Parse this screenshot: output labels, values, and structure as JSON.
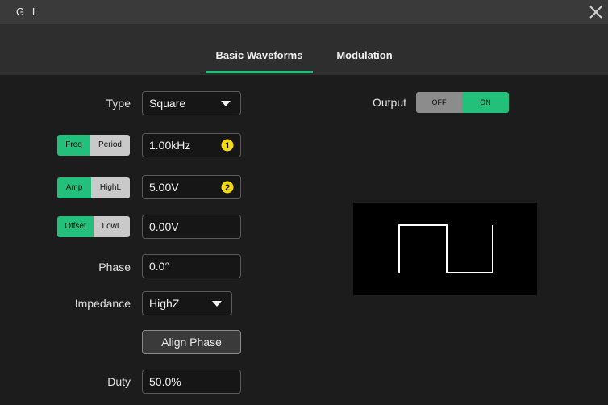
{
  "window": {
    "title": "G I"
  },
  "tabs": [
    {
      "label": "Basic Waveforms",
      "active": true
    },
    {
      "label": "Modulation",
      "active": false
    }
  ],
  "type": {
    "label": "Type",
    "value": "Square"
  },
  "freq": {
    "option_a": "Freq",
    "option_b": "Period",
    "selected": "Freq",
    "value": "1.00kHz",
    "badge": "1"
  },
  "amp": {
    "option_a": "Amp",
    "option_b": "HighL",
    "selected": "Amp",
    "value": "5.00V",
    "badge": "2"
  },
  "offset": {
    "option_a": "Offset",
    "option_b": "LowL",
    "selected": "Offset",
    "value": "0.00V"
  },
  "phase": {
    "label": "Phase",
    "value": "0.0°"
  },
  "impedance": {
    "label": "Impedance",
    "value": "HighZ"
  },
  "align_phase": {
    "label": "Align Phase"
  },
  "duty": {
    "label": "Duty",
    "value": "50.0%"
  },
  "output": {
    "label": "Output",
    "off_label": "OFF",
    "on_label": "ON",
    "state": "ON"
  },
  "colors": {
    "accent": "#22c07b",
    "badge": "#f5d90a",
    "inactive": "#c9c9c9"
  },
  "icons": {
    "close": "close-icon",
    "dropdown": "caret-down-icon",
    "badge": "numbered-circle-icon",
    "waveform": "square-wave-icon"
  }
}
